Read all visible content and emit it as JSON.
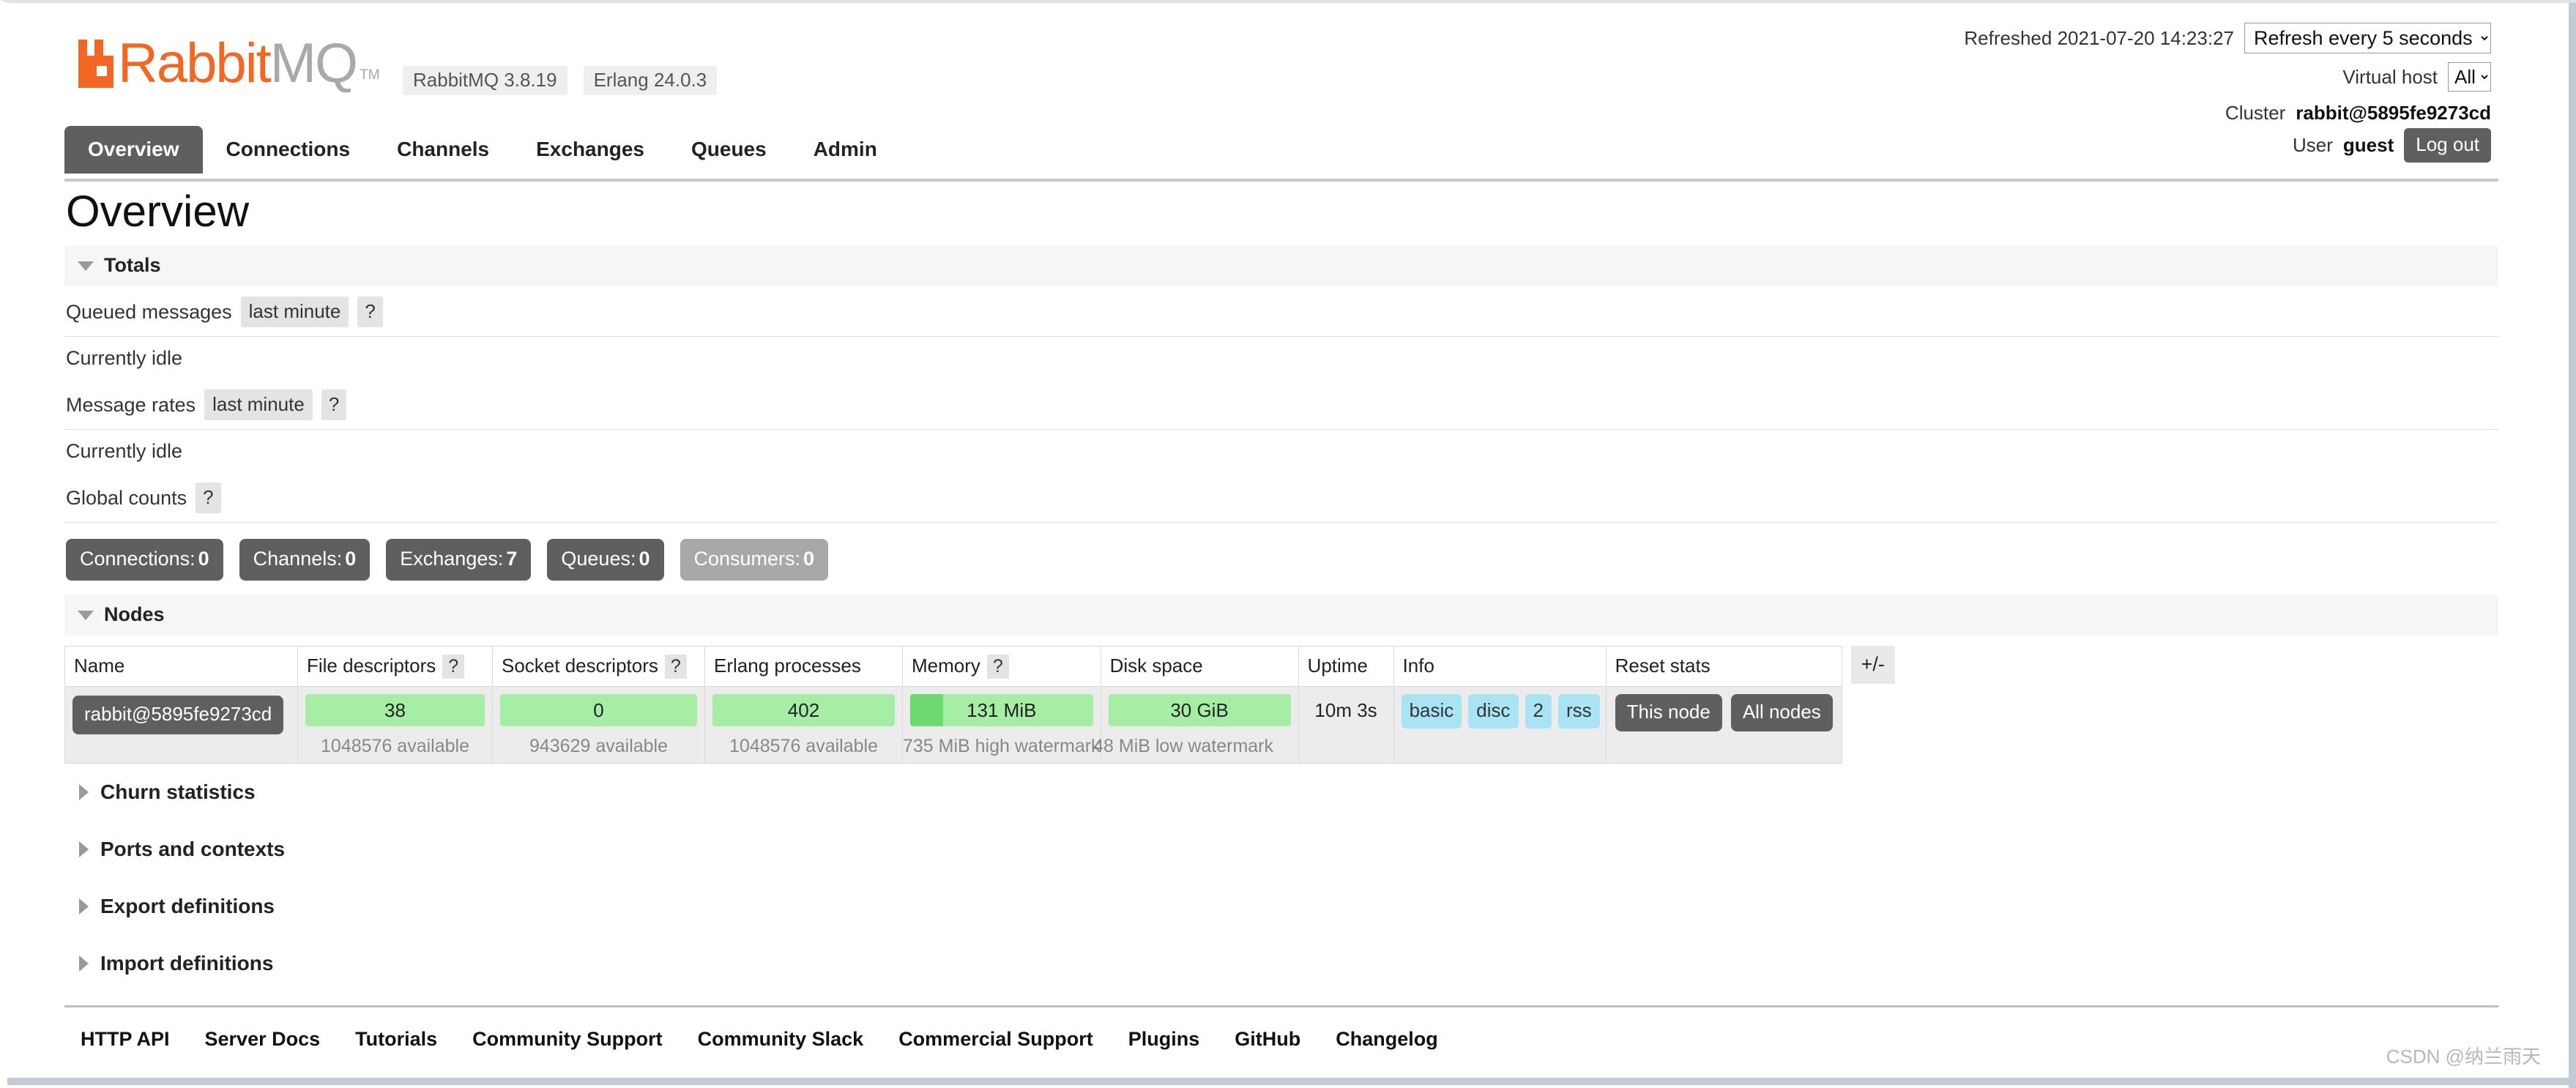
{
  "brand": {
    "name_part1": "Rabbit",
    "name_part2": "MQ",
    "tm": "TM",
    "logo_color": "#f26722",
    "badges": [
      "RabbitMQ 3.8.19",
      "Erlang 24.0.3"
    ]
  },
  "status": {
    "refreshed_label": "Refreshed 2021-07-20 14:23:27",
    "refresh_select_value": "Refresh every 5 seconds",
    "refresh_options": [
      "Refresh every 5 seconds"
    ],
    "vhost_label": "Virtual host",
    "vhost_value": "All",
    "vhost_options": [
      "All"
    ],
    "cluster_label": "Cluster",
    "cluster_value": "rabbit@5895fe9273cd",
    "user_label": "User",
    "user_value": "guest",
    "logout_label": "Log out"
  },
  "tabs": [
    {
      "label": "Overview",
      "active": true
    },
    {
      "label": "Connections",
      "active": false
    },
    {
      "label": "Channels",
      "active": false
    },
    {
      "label": "Exchanges",
      "active": false
    },
    {
      "label": "Queues",
      "active": false
    },
    {
      "label": "Admin",
      "active": false
    }
  ],
  "page_title": "Overview",
  "totals": {
    "section_title": "Totals",
    "queued_label": "Queued messages",
    "queued_chip": "last minute",
    "queued_help": "?",
    "queued_status": "Currently idle",
    "rates_label": "Message rates",
    "rates_chip": "last minute",
    "rates_help": "?",
    "rates_status": "Currently idle",
    "global_counts_label": "Global counts",
    "global_counts_help": "?"
  },
  "counts": [
    {
      "label": "Connections:",
      "value": "0",
      "muted": false
    },
    {
      "label": "Channels:",
      "value": "0",
      "muted": false
    },
    {
      "label": "Exchanges:",
      "value": "7",
      "muted": false
    },
    {
      "label": "Queues:",
      "value": "0",
      "muted": false
    },
    {
      "label": "Consumers:",
      "value": "0",
      "muted": true
    }
  ],
  "nodes": {
    "section_title": "Nodes",
    "columns": [
      {
        "label": "Name",
        "help": null
      },
      {
        "label": "File descriptors",
        "help": "?"
      },
      {
        "label": "Socket descriptors",
        "help": "?"
      },
      {
        "label": "Erlang processes",
        "help": null
      },
      {
        "label": "Memory",
        "help": "?"
      },
      {
        "label": "Disk space",
        "help": null
      },
      {
        "label": "Uptime",
        "help": null
      },
      {
        "label": "Info",
        "help": null
      },
      {
        "label": "Reset stats",
        "help": null
      }
    ],
    "plusminus": "+/-",
    "row": {
      "name": "rabbit@5895fe9273cd",
      "file_descriptors": {
        "value": "38",
        "sub": "1048576 available",
        "fill_pct": 0
      },
      "socket_descriptors": {
        "value": "0",
        "sub": "943629 available",
        "fill_pct": 0
      },
      "erlang_processes": {
        "value": "402",
        "sub": "1048576 available",
        "fill_pct": 0
      },
      "memory": {
        "value": "131 MiB",
        "sub": "735 MiB high watermark",
        "fill_pct": 18
      },
      "disk_space": {
        "value": "30 GiB",
        "sub": "48 MiB low watermark",
        "fill_pct": 0
      },
      "uptime": "10m 3s",
      "info": [
        "basic",
        "disc",
        "2",
        "rss"
      ],
      "reset": [
        "This node",
        "All nodes"
      ]
    }
  },
  "collapsed_sections": [
    {
      "label": "Churn statistics"
    },
    {
      "label": "Ports and contexts"
    },
    {
      "label": "Export definitions"
    },
    {
      "label": "Import definitions"
    }
  ],
  "footer_links": [
    "HTTP API",
    "Server Docs",
    "Tutorials",
    "Community Support",
    "Community Slack",
    "Commercial Support",
    "Plugins",
    "GitHub",
    "Changelog"
  ],
  "watermark": "CSDN @纳兰雨天"
}
